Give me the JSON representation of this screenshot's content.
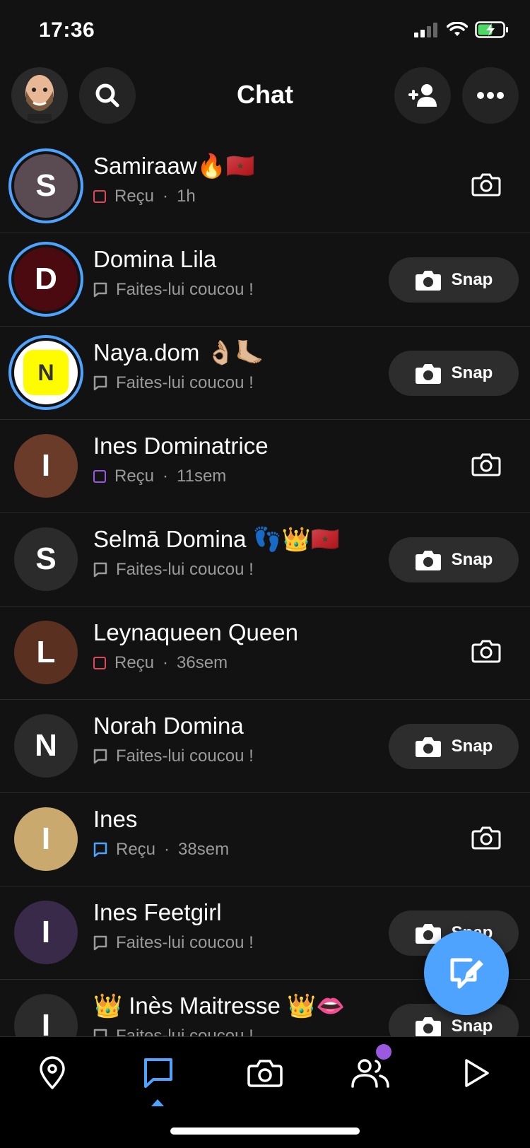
{
  "status_bar": {
    "time": "17:36"
  },
  "header": {
    "title": "Chat"
  },
  "chats": [
    {
      "name": "Samiraaw🔥🇲🇦",
      "status": "Reçu",
      "time": "1h",
      "square_color": "#e0475b",
      "action": "camera",
      "avatar_bg": "#5a4a52",
      "avatar_letter": "S"
    },
    {
      "name": "Domina Lila",
      "status": "Faites-lui coucou !",
      "time": "",
      "action": "snap",
      "avatar_bg": "#4a0a10",
      "avatar_letter": "D"
    },
    {
      "name": "Naya.dom 👌🏼🦶🏼",
      "status": "Faites-lui coucou !",
      "time": "",
      "action": "snap",
      "avatar_bg": "#fffc00",
      "avatar_letter": "N"
    },
    {
      "name": "Ines Dominatrice",
      "status": "Reçu",
      "time": "11sem",
      "square_color": "#9b59e0",
      "action": "camera",
      "avatar_bg": "#6b3b2a",
      "avatar_letter": "I"
    },
    {
      "name": "Selmā Domina 👣👑🇲🇦",
      "status": "Faites-lui coucou !",
      "time": "",
      "action": "snap",
      "avatar_bg": "#2b2b2b",
      "avatar_letter": "S"
    },
    {
      "name": "Leynaqueen Queen",
      "status": "Reçu",
      "time": "36sem",
      "square_color": "#e0475b",
      "action": "camera",
      "avatar_bg": "#5a3020",
      "avatar_letter": "L"
    },
    {
      "name": "Norah Domina",
      "status": "Faites-lui coucou !",
      "time": "",
      "action": "snap",
      "avatar_bg": "#2b2b2b",
      "avatar_letter": "N"
    },
    {
      "name": "Ines",
      "status": "Reçu",
      "time": "38sem",
      "square_color": "#4ea3ff",
      "action": "camera",
      "avatar_bg": "#c9a96e",
      "avatar_letter": "I"
    },
    {
      "name": "Ines Feetgirl",
      "status": "Faites-lui coucou !",
      "time": "",
      "action": "snap",
      "avatar_bg": "#3a2a4a",
      "avatar_letter": "I"
    },
    {
      "name": "👑 Inès Maitresse 👑👄",
      "status": "Faites-lui coucou !",
      "time": "",
      "action": "snap",
      "avatar_bg": "#2b2b2b",
      "avatar_letter": "I"
    }
  ],
  "labels": {
    "snap": "Snap"
  },
  "colors": {
    "accent": "#4ea3ff",
    "notification": "#9b59e0"
  },
  "nav": {
    "items": [
      "map-icon",
      "chat-icon",
      "camera-icon",
      "friends-icon",
      "stories-icon"
    ],
    "active": "chat-icon"
  }
}
